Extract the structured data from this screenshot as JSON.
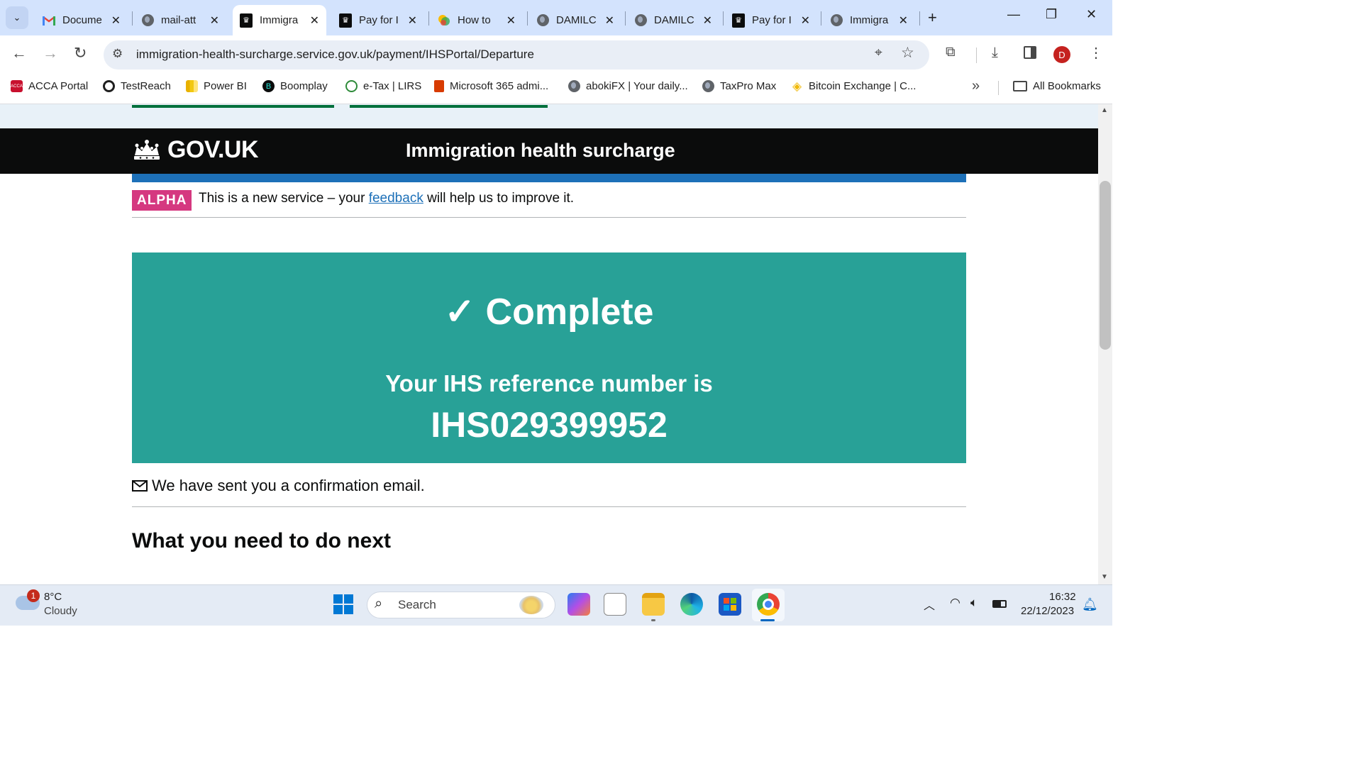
{
  "browser": {
    "tabs": [
      {
        "title": "Docume",
        "icon": "gmail-icon",
        "active": false
      },
      {
        "title": "mail-att",
        "icon": "globe-icon",
        "active": false
      },
      {
        "title": "Immigra",
        "icon": "govuk-crown-icon",
        "active": true
      },
      {
        "title": "Pay for I",
        "icon": "govuk-crown-icon",
        "active": false
      },
      {
        "title": "How to",
        "icon": "colorful-icon",
        "active": false
      },
      {
        "title": "DAMILC",
        "icon": "globe-icon",
        "active": false
      },
      {
        "title": "DAMILC",
        "icon": "globe-icon",
        "active": false
      },
      {
        "title": "Pay for I",
        "icon": "govuk-crown-icon",
        "active": false
      },
      {
        "title": "Immigra",
        "icon": "globe-icon",
        "active": false
      }
    ],
    "url": "immigration-health-surcharge.service.gov.uk/payment/IHSPortal/Departure",
    "profile_initial": "D",
    "bookmarks": [
      {
        "label": "ACCA Portal",
        "color": "#c8102e"
      },
      {
        "label": "TestReach",
        "color": "#1f1f1f"
      },
      {
        "label": "Power BI",
        "color": "#f2c811"
      },
      {
        "label": "Boomplay",
        "color": "#0b0c0c"
      },
      {
        "label": "e-Tax | LIRS",
        "color": "#2e8b3a"
      },
      {
        "label": "Microsoft 365 admi...",
        "color": "#d83b01"
      },
      {
        "label": "abokiFX | Your daily...",
        "color": "#5f6368"
      },
      {
        "label": "TaxPro Max",
        "color": "#5f6368"
      },
      {
        "label": "Bitcoin Exchange | C...",
        "color": "#f0b90b"
      }
    ],
    "all_bookmarks_label": "All Bookmarks",
    "overflow_label": "»"
  },
  "page": {
    "logo_text": "GOV.UK",
    "service_name": "Immigration health surcharge",
    "phase_tag": "ALPHA",
    "phase_text_before": "This is a new service – your ",
    "phase_link": "feedback",
    "phase_text_after": " will help us to improve it.",
    "panel_title": "✓ Complete",
    "panel_ref_label": "Your IHS reference number is",
    "panel_ref_number": "IHS029399952",
    "email_note": "We have sent you a confirmation email.",
    "next_heading": "What you need to do next",
    "colors": {
      "header": "#0b0c0c",
      "blue": "#1d70b8",
      "panel": "#28a197",
      "alpha": "#d53880"
    }
  },
  "taskbar": {
    "weather_temp": "8°C",
    "weather_desc": "Cloudy",
    "weather_badge": "1",
    "search_placeholder": "Search",
    "time": "16:32",
    "date": "22/12/2023"
  }
}
